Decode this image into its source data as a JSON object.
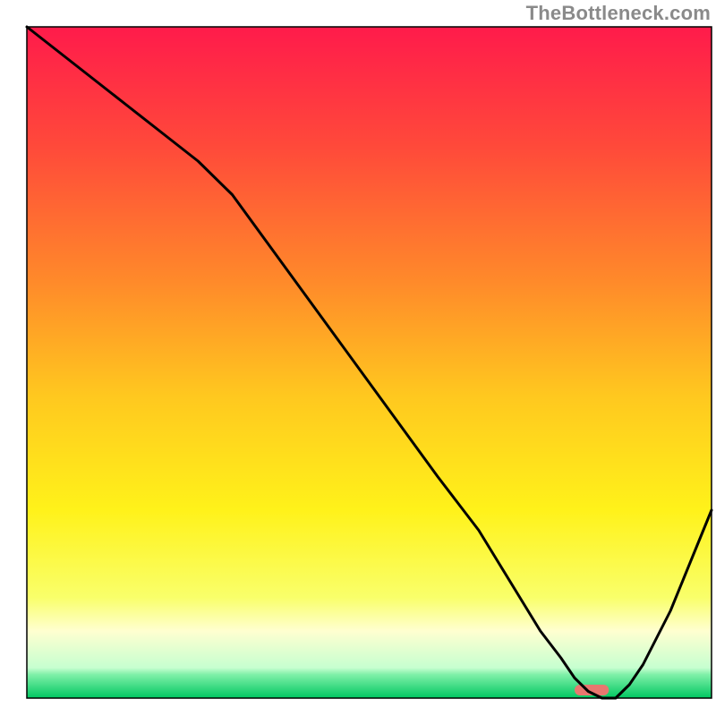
{
  "watermark": "TheBottleneck.com",
  "chart_data": {
    "type": "line",
    "title": "",
    "xlabel": "",
    "ylabel": "",
    "xlim": [
      0,
      100
    ],
    "ylim": [
      0,
      100
    ],
    "x": [
      0,
      5,
      10,
      15,
      20,
      25,
      30,
      35,
      40,
      45,
      50,
      55,
      60,
      63,
      66,
      69,
      72,
      75,
      78,
      80,
      82,
      84,
      86,
      88,
      90,
      92,
      94,
      96,
      98,
      100
    ],
    "values": [
      100,
      96,
      92,
      88,
      84,
      80,
      75,
      68,
      61,
      54,
      47,
      40,
      33,
      29,
      25,
      20,
      15,
      10,
      6,
      3,
      1,
      0,
      0,
      2,
      5,
      9,
      13,
      18,
      23,
      28
    ],
    "sweet_spot": {
      "x_start": 80,
      "x_end": 85,
      "y": 1.2
    },
    "gradient_stops": [
      {
        "offset": 0,
        "color": "#ff1b4b"
      },
      {
        "offset": 0.18,
        "color": "#ff4a3a"
      },
      {
        "offset": 0.38,
        "color": "#ff8a2a"
      },
      {
        "offset": 0.55,
        "color": "#ffc81f"
      },
      {
        "offset": 0.72,
        "color": "#fff21a"
      },
      {
        "offset": 0.85,
        "color": "#f9ff6a"
      },
      {
        "offset": 0.9,
        "color": "#ffffd0"
      },
      {
        "offset": 0.955,
        "color": "#c6ffd0"
      },
      {
        "offset": 0.965,
        "color": "#7ff0a8"
      },
      {
        "offset": 1.0,
        "color": "#00c761"
      }
    ],
    "layout": {
      "plot_left": 30,
      "plot_top": 30,
      "plot_right": 795,
      "plot_bottom": 780,
      "border_color": "#000000",
      "border_width": 1.5,
      "line_color": "#000000",
      "line_width": 3,
      "sweet_spot_color": "#e8776f",
      "sweet_spot_height": 12
    }
  }
}
